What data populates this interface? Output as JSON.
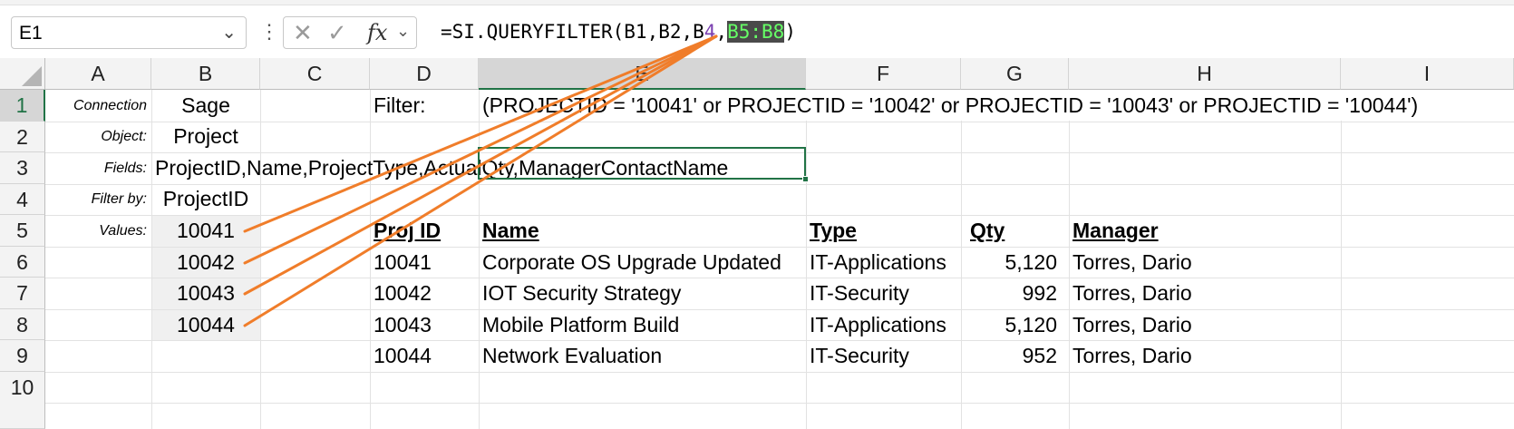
{
  "formula_bar": {
    "name_box": "E1",
    "cancel_icon": "✕",
    "enter_icon": "✓",
    "fx_label": "fx",
    "formula_prefix": "=SI.QUERYFILTER(B1,B2,B",
    "formula_ref4": "4",
    "formula_comma": ",",
    "formula_ref58": "B5:B8",
    "formula_suffix": ")"
  },
  "columns": [
    "A",
    "B",
    "C",
    "D",
    "E",
    "F",
    "G",
    "H",
    "I"
  ],
  "rows": [
    "1",
    "2",
    "3",
    "4",
    "5",
    "6",
    "7",
    "8",
    "9",
    "10"
  ],
  "labels": {
    "connection": "Connection",
    "object": "Object:",
    "fields": "Fields:",
    "filter_by": "Filter by:",
    "values": "Values:"
  },
  "inputs": {
    "connection": "Sage",
    "object": "Project",
    "fields": "ProjectID,Name,ProjectType,ActualQty,ManagerContactName",
    "filter_by": "ProjectID",
    "values": [
      "10041",
      "10042",
      "10043",
      "10044"
    ]
  },
  "filter": {
    "label": "Filter:",
    "value": "(PROJECTID = '10041' or PROJECTID = '10042' or PROJECTID = '10043' or PROJECTID = '10044')"
  },
  "table": {
    "headers": [
      "Proj ID",
      "Name",
      "Type",
      "Qty",
      "Manager"
    ],
    "rows": [
      [
        "10041",
        "Corporate OS Upgrade Updated",
        "IT-Applications",
        "5,120",
        "Torres, Dario"
      ],
      [
        "10042",
        "IOT Security Strategy",
        "IT-Security",
        "992",
        "Torres, Dario"
      ],
      [
        "10043",
        "Mobile Platform Build",
        "IT-Applications",
        "5,120",
        "Torres, Dario"
      ],
      [
        "10044",
        "Network Evaluation",
        "IT-Security",
        "952",
        "Torres, Dario"
      ]
    ]
  },
  "colors": {
    "arrow": "#f07d2a",
    "selection": "#217346",
    "ref_purple": "#7a3fb0",
    "ref_green": "#66ff66"
  }
}
